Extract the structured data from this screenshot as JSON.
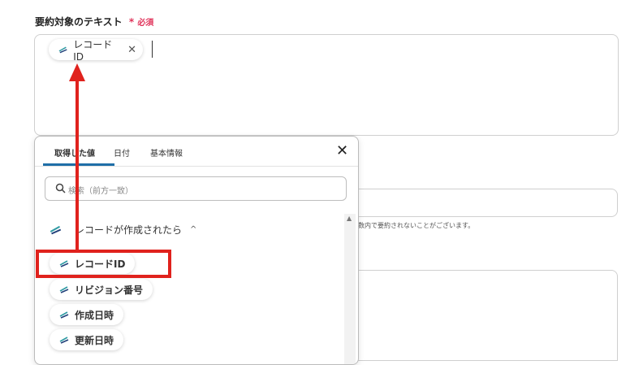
{
  "field": {
    "label": "要約対象のテキスト",
    "required_star": "*",
    "required_text": "必須",
    "selected_chip": {
      "label": "レコードID",
      "close_glyph": "✕",
      "icon": "leaf-icon"
    }
  },
  "background": {
    "note_text": "数内で要約されないことがございます。"
  },
  "popup": {
    "tabs": [
      {
        "label": "取得した値",
        "active": true
      },
      {
        "label": "日付",
        "active": false
      },
      {
        "label": "基本情報",
        "active": false
      }
    ],
    "close_glyph": "✕",
    "search": {
      "placeholder": "検索（前方一致）",
      "icon": "search-icon"
    },
    "group": {
      "title": "レコードが作成されたら",
      "caret": "^",
      "icon": "leaf-icon"
    },
    "items": [
      {
        "label": "レコードID",
        "icon": "leaf-icon"
      },
      {
        "label": "リビジョン番号",
        "icon": "leaf-icon"
      },
      {
        "label": "作成日時",
        "icon": "leaf-icon"
      },
      {
        "label": "更新日時",
        "icon": "leaf-icon"
      }
    ]
  },
  "colors": {
    "required": "#e0335a",
    "tab_accent": "#1f6fa8",
    "annotation": "#e0221d",
    "icon_teal": "#2f9aa3",
    "icon_navy": "#21407a"
  }
}
